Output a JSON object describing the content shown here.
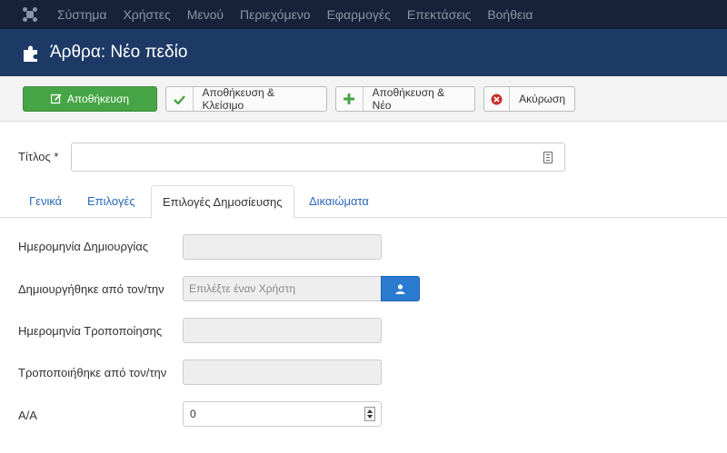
{
  "topbar": {
    "items": [
      "Σύστημα",
      "Χρήστες",
      "Μενού",
      "Περιεχόμενο",
      "Εφαρμογές",
      "Επεκτάσεις",
      "Βοήθεια"
    ]
  },
  "header": {
    "title": "Άρθρα: Νέο πεδίο"
  },
  "toolbar": {
    "save": "Αποθήκευση",
    "save_close": "Αποθήκευση & Κλείσιμο",
    "save_new": "Αποθήκευση & Νέο",
    "cancel": "Ακύρωση"
  },
  "form": {
    "title_label": "Τίτλος *",
    "title_value": ""
  },
  "tabs": [
    "Γενικά",
    "Επιλογές",
    "Επιλογές Δημοσίευσης",
    "Δικαιώματα"
  ],
  "active_tab": "Επιλογές Δημοσίευσης",
  "publishing": {
    "created_date_label": "Ημερομηνία Δημιουργίας",
    "created_by_label": "Δημιουργήθηκε από τον/την",
    "created_by_placeholder": "Επιλέξτε έναν Χρήστη",
    "modified_date_label": "Ημερομηνία Τροποποίησης",
    "modified_by_label": "Τροποποιήθηκε από τον/την",
    "id_label": "Α/Α",
    "id_value": "0"
  },
  "colors": {
    "topbar": "#17223a",
    "header": "#1d3a66",
    "save_button": "#46a546",
    "user_button": "#2b7bd1",
    "link": "#2a69b8"
  }
}
